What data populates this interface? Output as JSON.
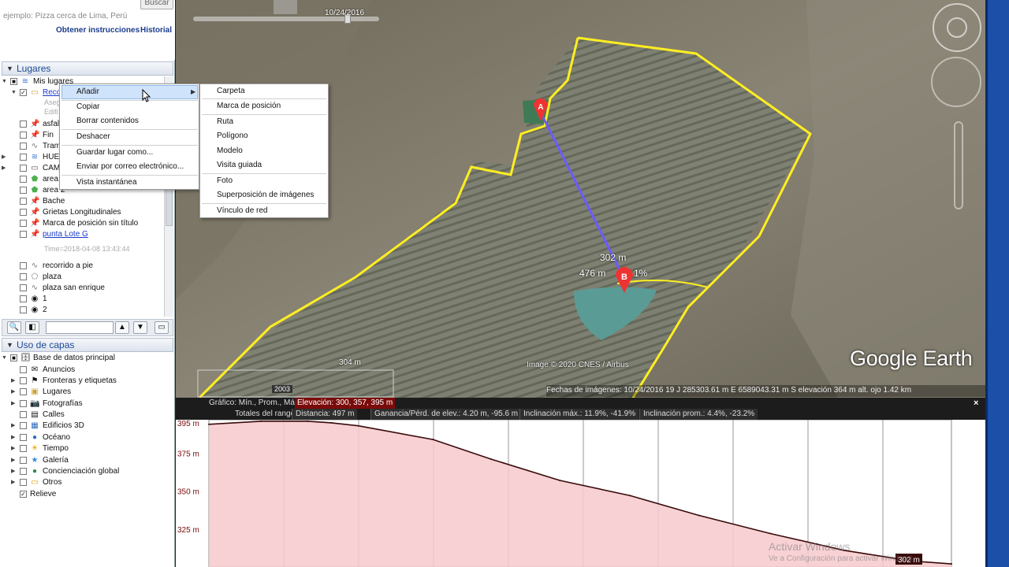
{
  "search": {
    "hint": "ejemplo: Pizza cerca de Lima, Perú",
    "button": "Buscar",
    "directions": "Obtener instrucciones",
    "history": "Historial"
  },
  "places": {
    "header": "Lugares",
    "rows": [
      {
        "label": "Mis lugares"
      },
      {
        "label": "Reco"
      },
      {
        "label": "Aseg"
      },
      {
        "label": "Edifi"
      },
      {
        "label": "asfal"
      },
      {
        "label": "Fin"
      },
      {
        "label": "Tram"
      },
      {
        "label": "HUE"
      },
      {
        "label": "CAM"
      },
      {
        "label": "area"
      },
      {
        "label": "area 2"
      },
      {
        "label": "Bache"
      },
      {
        "label": "Grietas Longitudinales"
      },
      {
        "label": "Marca de posición sin título"
      },
      {
        "label": "punta Lote G"
      },
      {
        "label": "Time=2018-04-08 13:43:44"
      },
      {
        "label": "recorrido a pie"
      },
      {
        "label": "plaza"
      },
      {
        "label": "plaza san enrique"
      },
      {
        "label": "1"
      },
      {
        "label": "2"
      }
    ]
  },
  "layers": {
    "header": "Uso de capas",
    "rows": [
      {
        "label": "Base de datos principal"
      },
      {
        "label": "Anuncios"
      },
      {
        "label": "Fronteras y etiquetas"
      },
      {
        "label": "Lugares"
      },
      {
        "label": "Fotografías"
      },
      {
        "label": "Calles"
      },
      {
        "label": "Edificios 3D"
      },
      {
        "label": "Océano"
      },
      {
        "label": "Tiempo"
      },
      {
        "label": "Galería"
      },
      {
        "label": "Concienciación global"
      },
      {
        "label": "Otros"
      },
      {
        "label": "Relieve"
      }
    ]
  },
  "context_menu": {
    "items": [
      "Añadir",
      "Copiar",
      "Borrar contenidos",
      "Deshacer",
      "Guardar lugar como...",
      "Enviar por correo electrónico...",
      "Vista instantánea"
    ]
  },
  "submenu": {
    "items": [
      "Carpeta",
      "Marca de posición",
      "Ruta",
      "Polígono",
      "Modelo",
      "Visita guiada",
      "Foto",
      "Superposición de imágenes",
      "Vínculo de red"
    ]
  },
  "map": {
    "timeline_date": "10/24/2016",
    "label_302": "302 m",
    "label_476": "476 m",
    "label_pct": "1%",
    "label_304": "304 m",
    "watermark": "Google Earth",
    "image_credit": "Image © 2020 CNES / Airbus",
    "year_badge": "2003",
    "status": "Fechas de imágenes: 10/24/2016      19 J 285303.61 m E 6589043.31 m S  elevación   364 m    alt. ojo   1.42 km",
    "marker_a": "A",
    "marker_b": "B"
  },
  "profile": {
    "graph_label": "Gráfico: Mín., Prom., Máx:",
    "elevation": "Elevación: 300, 357, 395 m",
    "range_label": "Totales del rango:",
    "distance": "Distancia: 497 m",
    "gain_loss": "Ganancia/Pérd. de elev.: 4.20 m, -95.6 m",
    "max_slope": "Inclinación máx.: 11.9%, -41.9%",
    "avg_slope": "Inclinación prom.: 4.4%, -23.2%",
    "close": "×",
    "end_label": "302 m",
    "activate_title": "Activar Windows",
    "activate_sub": "Ve a Configuración para activar Windows."
  },
  "chart_data": {
    "type": "area",
    "x": [
      0,
      35,
      66,
      82,
      100,
      150,
      189,
      235,
      282,
      328,
      376,
      425,
      470,
      497
    ],
    "values": [
      394,
      396,
      396,
      395,
      393,
      384,
      371,
      357,
      347,
      334,
      322,
      311,
      304,
      302
    ],
    "xlabel": "",
    "ylabel": "",
    "yticks": [
      "395 m",
      "375 m",
      "350 m",
      "325 m"
    ],
    "ylim": [
      300,
      397
    ],
    "grid": true,
    "colors": {
      "fill": "#f6c9cc",
      "line": "#3a0a0a"
    }
  }
}
